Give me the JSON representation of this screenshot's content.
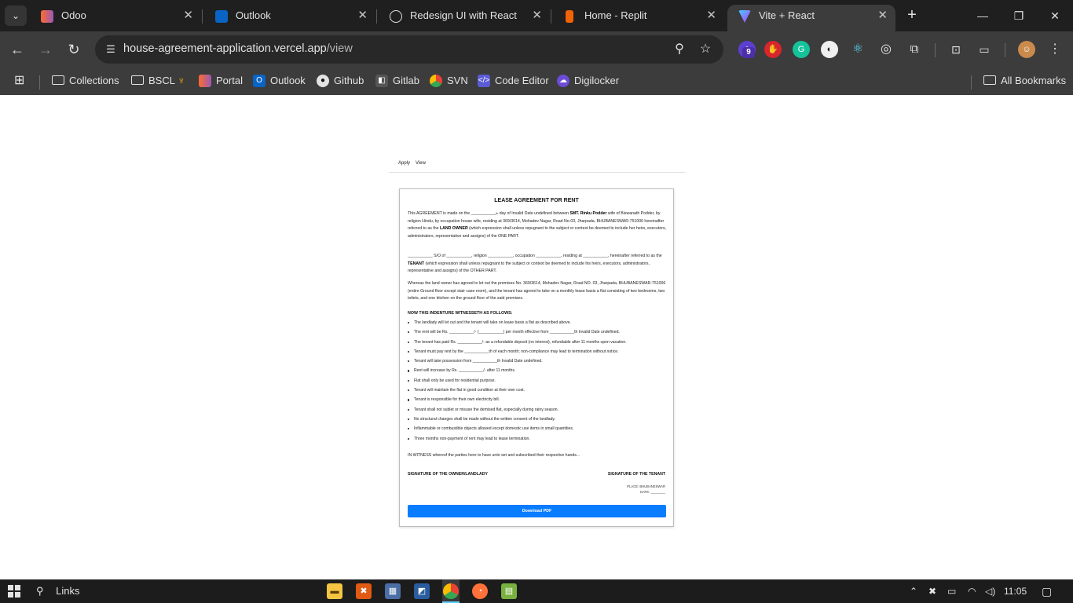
{
  "browser": {
    "tabs": [
      {
        "title": "Odoo",
        "active": false
      },
      {
        "title": "Outlook",
        "active": false
      },
      {
        "title": "Redesign UI with React",
        "active": false
      },
      {
        "title": "Home - Replit",
        "active": false
      },
      {
        "title": "Vite + React",
        "active": true
      }
    ],
    "url_host": "house-agreement-application.vercel.app",
    "url_path": "/view",
    "extension_badge": "9",
    "bookmarks": [
      "Collections",
      "BSCL",
      "Portal",
      "Outlook",
      "Github",
      "Gitlab",
      "SVN",
      "Code Editor",
      "Digilocker"
    ],
    "all_bookmarks": "All Bookmarks"
  },
  "appnav": {
    "apply": "Apply",
    "view": "View"
  },
  "document": {
    "title": "LEASE AGREEMENT FOR RENT",
    "p1_a": "This AGREEMENT is made on the ___________",
    "p1_sup": "th",
    "p1_b": " day of Invalid Date undefined between ",
    "p1_owner": "SMT. Rinku Podder",
    "p1_c": " wife of Biswanath Podder, by religion Hindu, by occupation house wife, residing at 369/3614, Mohadev Nagar, Road No-03, Jharpada, BHUBANESWAR-751006 hereinafter referred to as the ",
    "p1_role": "LAND OWNER",
    "p1_d": " (which expression shall unless repugnant to the subject or context be deemed to include her heirs, executors, administrators, representative and assigns) of the ONE PART.",
    "p2_a": "___________ S/O of ___________, religion ___________, occupation ___________, residing at ___________, hereinafter referred to as the ",
    "p2_role": "TENANT",
    "p2_b": " (which expression shall unless repugnant to the subject or context be deemed to include his heirs, executors, administrators, representative and assigns) of the OTHER PART.",
    "p3": "Whereas the land owner has agreed to let out the premises No. 369/3614, Mohadev Nagar, Road NO. 03, Jharpada, BHUBANESWAR-751006 (entire Ground floor except stair case room), and the tenant has agreed to take on a monthly lease basis a flat consisting of two bedrooms, two toilets, and one kitchen on the ground floor of the said premises.",
    "heading": "NOW THIS INDENTURE WITNESSETH AS FOLLOWS:",
    "clauses": [
      "The landlady will let out and the tenant will take on lease basis a flat as described above.",
      "The rent will be Rs. ___________/- (___________) per month effective from ___________th Invalid Date undefined.",
      "The tenant has paid Rs. ___________/- as a refundable deposit (no interest), refundable after 11 months upon vacation.",
      "Tenant must pay rent by the ___________th of each month; non-compliance may lead to termination without notice.",
      "Tenant will take possession from ___________th Invalid Date undefined.",
      "Rent will increase by Rs. ___________/- after 11 months.",
      "Flat shall only be used for residential purpose.",
      "Tenant will maintain the flat in good condition at their own cost.",
      "Tenant is responsible for their own electricity bill.",
      "Tenant shall not sublet or misuse the demised flat, especially during rainy season.",
      "No structural changes shall be made without the written consent of the landlady.",
      "Inflammable or combustible objects allowed except domestic use items in small quantities.",
      "Three months non-payment of rent may lead to lease termination."
    ],
    "witness": "IN WITNESS whereof the parties here to have unto set and subscribed their respective hands...",
    "sig_owner": "SIGNATURE OF THE OWNER/LANDLADY",
    "sig_tenant": "SIGNATURE OF THE TENANT",
    "place": "PLACE: BHUBANESWAR",
    "date": "DATE: ________",
    "download_label": "Download PDF"
  },
  "taskbar": {
    "search_label": "Links",
    "time": "11:05"
  },
  "colors": {
    "accent": "#0a7cff",
    "chrome_dark": "#1f1f1f",
    "chrome": "#3c3c3c"
  }
}
